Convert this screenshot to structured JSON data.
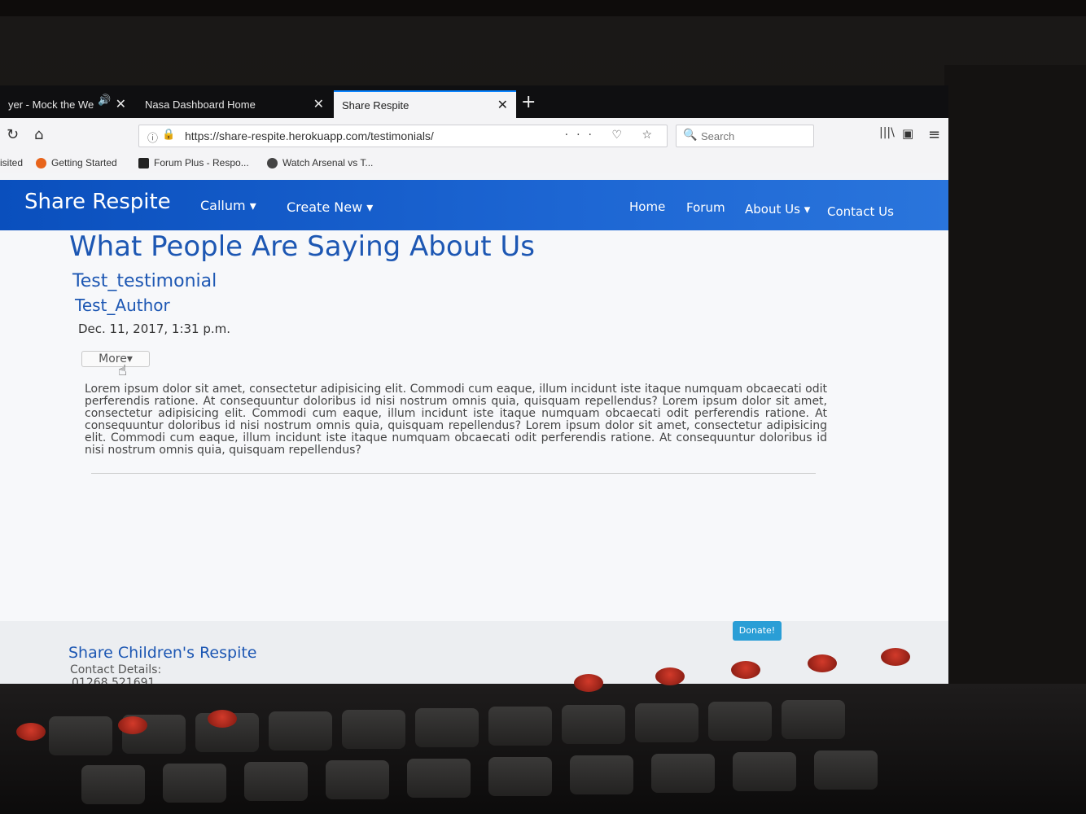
{
  "browser": {
    "tabs": [
      {
        "label": "yer - Mock the We",
        "active": false
      },
      {
        "label": "Nasa Dashboard Home",
        "active": false
      },
      {
        "label": "Share Respite",
        "active": true
      }
    ],
    "url": "https://share-respite.herokuapp.com/testimonials/",
    "url_actions": "··· ♡ ☆",
    "search_placeholder": "Search",
    "bookmarks": [
      {
        "label": "isited",
        "icon": "none"
      },
      {
        "label": "Getting Started",
        "icon": "firefox-icon"
      },
      {
        "label": "Forum Plus - Respo...",
        "icon": "forum-icon"
      },
      {
        "label": "Watch Arsenal vs T...",
        "icon": "football-icon"
      }
    ]
  },
  "navbar": {
    "brand": "Share Respite",
    "left_items": [
      "Callum",
      "Create New"
    ],
    "right_items": [
      "Home",
      "Forum",
      "About Us",
      "Contact Us"
    ],
    "color": "#1560cf"
  },
  "page": {
    "title": "What People Are Saying About Us",
    "testimonial": {
      "title": "Test_testimonial",
      "author": "Test_Author",
      "date": "Dec. 11, 2017, 1:31 p.m.",
      "more_label": "More",
      "body": "Lorem ipsum dolor sit amet, consectetur adipisicing elit. Commodi cum eaque, illum incidunt iste itaque numquam obcaecati odit perferendis ratione. At consequuntur doloribus id nisi nostrum omnis quia, quisquam repellendus? Lorem ipsum dolor sit amet, consectetur adipisicing elit. Commodi cum eaque, illum incidunt iste itaque numquam obcaecati odit perferendis ratione. At consequuntur doloribus id nisi nostrum omnis quia, quisquam repellendus? Lorem ipsum dolor sit amet, consectetur adipisicing elit. Commodi cum eaque, illum incidunt iste itaque numquam obcaecati odit perferendis ratione. At consequuntur doloribus id nisi nostrum omnis quia, quisquam repellendus?"
    }
  },
  "footer": {
    "donate_label": "Donate!",
    "org_name": "Share Children's Respite",
    "contact_label": "Contact Details:",
    "phone": "01268 521691"
  }
}
